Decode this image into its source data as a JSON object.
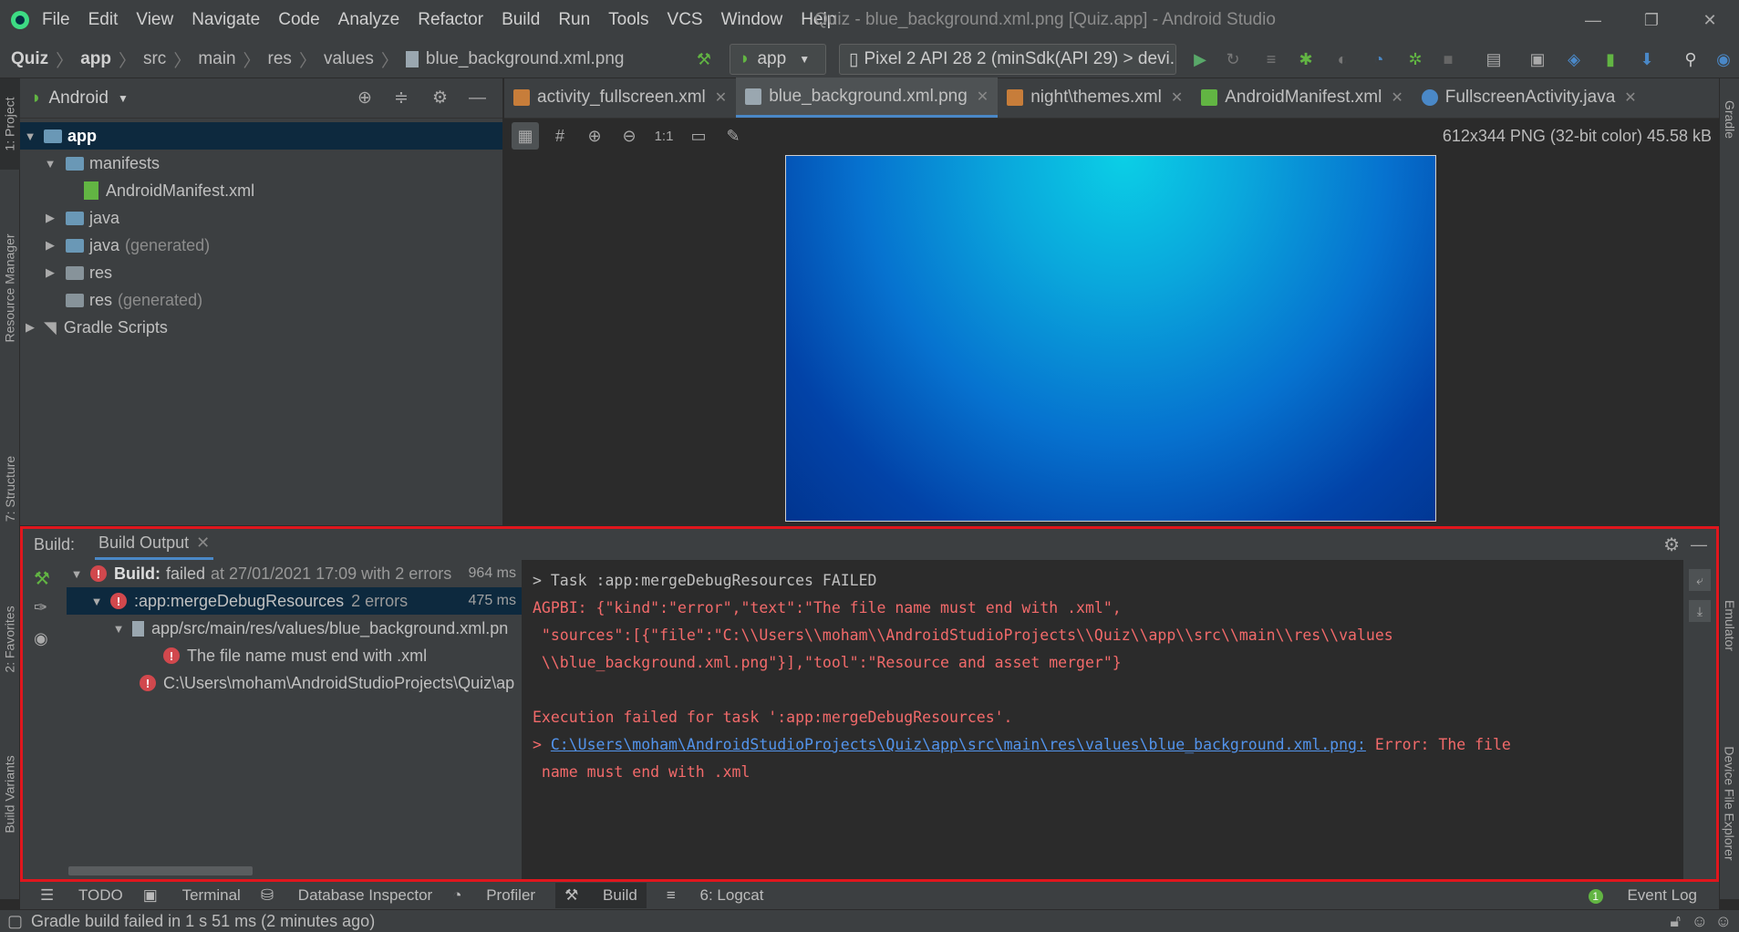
{
  "menubar": {
    "items": [
      "File",
      "Edit",
      "View",
      "Navigate",
      "Code",
      "Analyze",
      "Refactor",
      "Build",
      "Run",
      "Tools",
      "VCS",
      "Window",
      "Help"
    ],
    "title": "Quiz - blue_background.xml.png [Quiz.app] - Android Studio"
  },
  "breadcrumb": [
    "Quiz",
    "app",
    "src",
    "main",
    "res",
    "values",
    "blue_background.xml.png"
  ],
  "toolbar": {
    "run_config": "app",
    "device": "Pixel 2 API 28 2 (minSdk(API 29) > devi..."
  },
  "left_strip": {
    "project": "1: Project",
    "resource_manager": "Resource Manager",
    "structure": "7: Structure",
    "favorites": "2: Favorites",
    "build_variants": "Build Variants"
  },
  "right_strip": {
    "gradle": "Gradle",
    "emulator": "Emulator",
    "device_file_explorer": "Device File Explorer"
  },
  "project": {
    "view_mode": "Android",
    "tree": [
      {
        "label": "app"
      },
      {
        "label": "manifests"
      },
      {
        "label": "AndroidManifest.xml"
      },
      {
        "label": "java"
      },
      {
        "label": "java",
        "suffix": "(generated)"
      },
      {
        "label": "res"
      },
      {
        "label": "res",
        "suffix": "(generated)"
      },
      {
        "label": "Gradle Scripts"
      }
    ]
  },
  "editor": {
    "tabs": [
      {
        "label": "activity_fullscreen.xml",
        "icon_color": "#c77d3a"
      },
      {
        "label": "blue_background.xml.png",
        "icon_color": "#9aa7b0"
      },
      {
        "label": "night\\themes.xml",
        "icon_color": "#c77d3a"
      },
      {
        "label": "AndroidManifest.xml",
        "icon_color": "#62b543"
      },
      {
        "label": "FullscreenActivity.java",
        "icon_color": "#4a88c7"
      }
    ],
    "image_info": "612x344 PNG (32-bit color) 45.58 kB",
    "zoom_actual": "1:1"
  },
  "build": {
    "label": "Build:",
    "tab": "Build Output",
    "tree": {
      "root_title": "Build:",
      "root_status": "failed",
      "root_detail": "at 27/01/2021 17:09 with 2 errors",
      "root_time": "964 ms",
      "task": ":app:mergeDebugResources",
      "task_detail": "2 errors",
      "task_time": "475 ms",
      "file": "app/src/main/res/values/blue_background.xml.pn",
      "file_error": "The file name must end with .xml",
      "path_error": "C:\\Users\\moham\\AndroidStudioProjects\\Quiz\\ap"
    },
    "output": {
      "line1": "> Task :app:mergeDebugResources FAILED",
      "line2": "AGPBI: {\"kind\":\"error\",\"text\":\"The file name must end with .xml\",",
      "line3": " \"sources\":[{\"file\":\"C:\\\\Users\\\\moham\\\\AndroidStudioProjects\\\\Quiz\\\\app\\\\src\\\\main\\\\res\\\\values",
      "line4": " \\\\blue_background.xml.png\"}],\"tool\":\"Resource and asset merger\"}",
      "line5": "Execution failed for task ':app:mergeDebugResources'.",
      "link_prefix": "> ",
      "link": "C:\\Users\\moham\\AndroidStudioProjects\\Quiz\\app\\src\\main\\res\\values\\blue_background.xml.png:",
      "link_suffix": " Error: The file",
      "line7": " name must end with .xml"
    }
  },
  "bottom_tabs": [
    "TODO",
    "Terminal",
    "Database Inspector",
    "Profiler",
    "Build",
    "6: Logcat"
  ],
  "event_log": "Event Log",
  "event_log_count": "1",
  "status": "Gradle build failed in 1 s 51 ms (2 minutes ago)"
}
